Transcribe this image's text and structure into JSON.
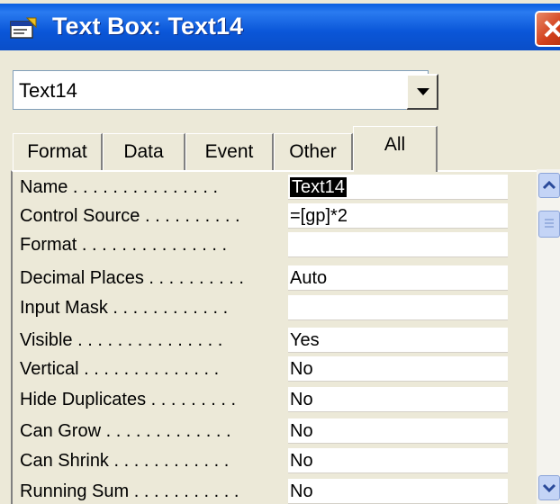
{
  "window": {
    "title": "Text Box: Text14",
    "title_icon": "properties-sheet-icon",
    "close_icon": "close-icon",
    "title_bar_color": "#0a56d8",
    "close_color": "#d2401c"
  },
  "selector": {
    "value": "Text14"
  },
  "tabs": [
    {
      "label": "Format"
    },
    {
      "label": "Data"
    },
    {
      "label": "Event"
    },
    {
      "label": "Other"
    },
    {
      "label": "All",
      "active": true
    }
  ],
  "properties": [
    {
      "name": "Name . . . . . . . . . . . . . . .",
      "value": "Text14",
      "selected": true
    },
    {
      "name": "Control Source . . . . . . . . . .",
      "value": "=[gp]*2"
    },
    {
      "name": "Format . . . . . . . . . . . . . . .",
      "value": ""
    },
    {
      "name": "Decimal Places . . . . . . . . . .",
      "value": "Auto"
    },
    {
      "name": "Input Mask . . . . . . . . . . . .",
      "value": ""
    },
    {
      "name": "Visible . . . . . . . . . . . . . . .",
      "value": "Yes"
    },
    {
      "name": "Vertical . . . . . . . . . . . . . .",
      "value": "No"
    },
    {
      "name": "Hide Duplicates . . . . . . . . .",
      "value": "No"
    },
    {
      "name": "Can Grow . . . . . . . . . . . . .",
      "value": "No"
    },
    {
      "name": "Can Shrink . . . . . . . . . . . .",
      "value": "No"
    },
    {
      "name": "Running Sum . . . . . . . . . . .",
      "value": "No"
    }
  ]
}
